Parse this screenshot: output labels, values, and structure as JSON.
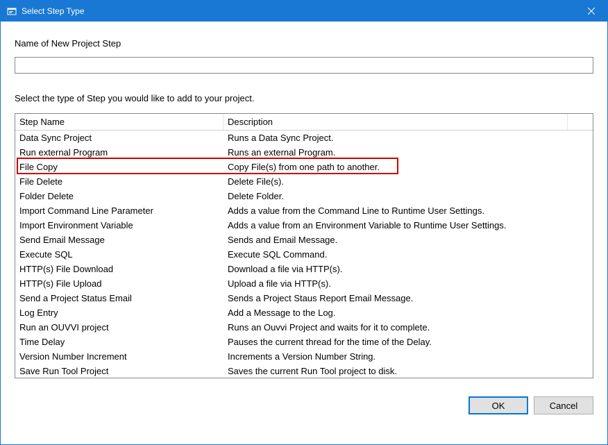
{
  "titlebar": {
    "title": "Select Step Type"
  },
  "form": {
    "name_label": "Name of New Project Step",
    "name_value": "",
    "instruction": "Select the type of Step you would like to add to your project."
  },
  "list": {
    "header_name": "Step Name",
    "header_desc": "Description",
    "highlighted_index": 2,
    "rows": [
      {
        "name": "Data Sync Project",
        "desc": "Runs a Data Sync Project."
      },
      {
        "name": "Run external Program",
        "desc": "Runs an external Program."
      },
      {
        "name": "File Copy",
        "desc": "Copy File(s) from one path to another."
      },
      {
        "name": "File Delete",
        "desc": "Delete File(s)."
      },
      {
        "name": "Folder Delete",
        "desc": "Delete Folder."
      },
      {
        "name": "Import Command Line Parameter",
        "desc": "Adds a value from the Command Line to Runtime User Settings."
      },
      {
        "name": "Import Environment Variable",
        "desc": "Adds a value from an Environment Variable to Runtime User Settings."
      },
      {
        "name": "Send Email Message",
        "desc": "Sends and Email Message."
      },
      {
        "name": "Execute SQL",
        "desc": "Execute SQL Command."
      },
      {
        "name": "HTTP(s) File Download",
        "desc": "Download a file via HTTP(s)."
      },
      {
        "name": "HTTP(s) File Upload",
        "desc": "Upload a file via HTTP(s)."
      },
      {
        "name": "Send a Project Status Email",
        "desc": "Sends a Project Staus Report Email Message."
      },
      {
        "name": "Log Entry",
        "desc": "Add a Message to the Log."
      },
      {
        "name": "Run an OUVVI project",
        "desc": "Runs an Ouvvi Project and waits for it to complete."
      },
      {
        "name": "Time Delay",
        "desc": "Pauses the current thread for the time of the Delay."
      },
      {
        "name": "Version Number Increment",
        "desc": "Increments a Version Number String."
      },
      {
        "name": "Save Run Tool Project",
        "desc": "Saves the current Run Tool project to disk."
      }
    ]
  },
  "buttons": {
    "ok": "OK",
    "cancel": "Cancel"
  }
}
